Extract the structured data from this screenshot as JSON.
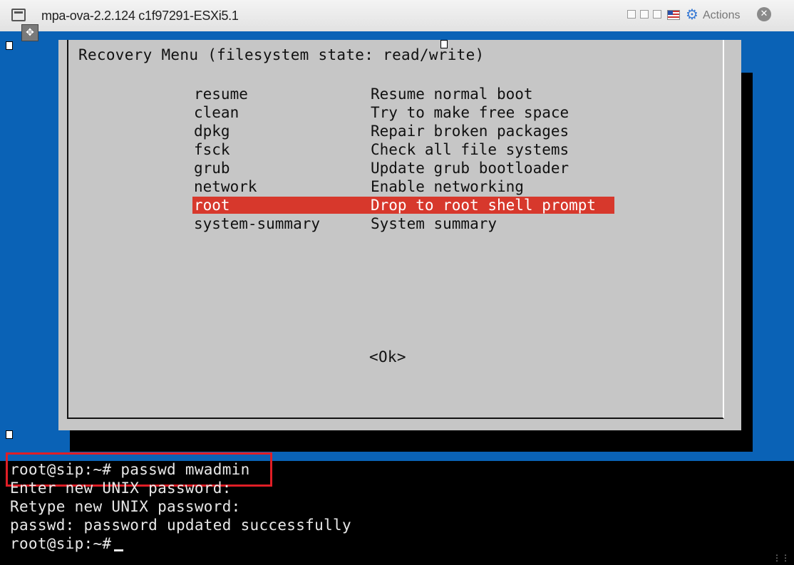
{
  "window": {
    "title": "mpa-ova-2.2.124 c1f97291-ESXi5.1",
    "actions_label": "Actions",
    "icons": [
      "vm-console-icon",
      "move-handle-icon",
      "minimize-icon",
      "restore-icon",
      "maximize-icon",
      "flag-icon",
      "gear-icon",
      "close-icon"
    ]
  },
  "recovery_menu": {
    "title": "Recovery Menu (filesystem state: read/write)",
    "items": [
      {
        "key": "resume",
        "description": "Resume normal boot"
      },
      {
        "key": "clean",
        "description": "Try to make free space"
      },
      {
        "key": "dpkg",
        "description": "Repair broken packages"
      },
      {
        "key": "fsck",
        "description": "Check all file systems"
      },
      {
        "key": "grub",
        "description": "Update grub bootloader"
      },
      {
        "key": "network",
        "description": "Enable networking"
      },
      {
        "key": "root",
        "description": "Drop to root shell prompt"
      },
      {
        "key": "system-summary",
        "description": "System summary"
      }
    ],
    "selected_key": "root",
    "ok_label": "<Ok>"
  },
  "terminal": {
    "lines": [
      "root@sip:~# passwd mwadmin",
      "Enter new UNIX password:",
      "Retype new UNIX password:",
      "passwd: password updated successfully",
      "root@sip:~#"
    ]
  },
  "colors": {
    "console_background": "#0a62b6",
    "dialog_background": "#c6c6c6",
    "selection": "#d7382c",
    "highlight_box": "#e01e26",
    "terminal_background": "#000000"
  }
}
